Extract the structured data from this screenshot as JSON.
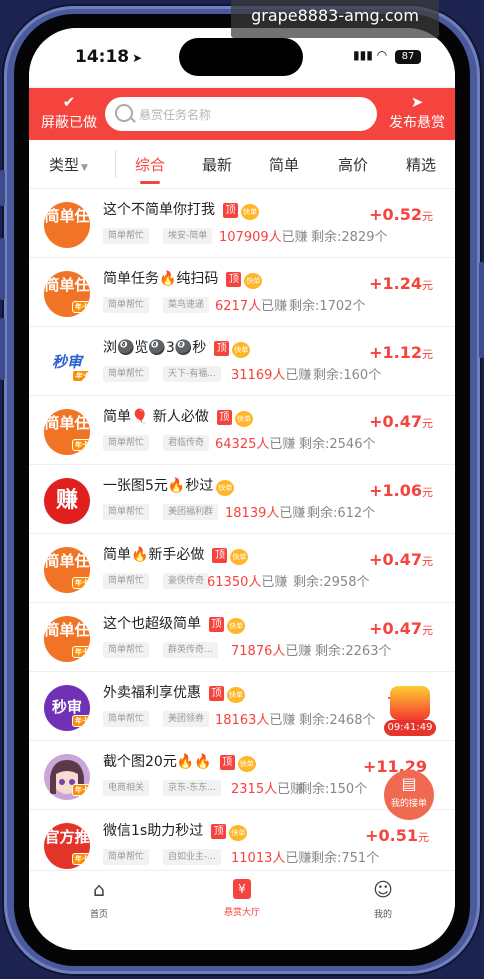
{
  "status_bar": {
    "time": "14:18",
    "battery": "87"
  },
  "watermark": "grape8883-amg.com",
  "header": {
    "left_label": "屏蔽已做",
    "search_placeholder": "悬赏任务名称",
    "right_label": "发布悬赏"
  },
  "tabs": {
    "filter_label": "类型",
    "items": [
      "综合",
      "最新",
      "简单",
      "高价",
      "精选"
    ],
    "active": "综合"
  },
  "tags": {
    "top": "顶",
    "fast": "快单",
    "card": "年卡"
  },
  "tasks": [
    {
      "avatar_text": "简单任",
      "title": "这个不简单你打我",
      "chip1": "简单帮忙",
      "chip2": "埃安-简单",
      "earned": "107909人",
      "earned_suffix": "已赚",
      "remaining": "剩余:2829个",
      "price": "+0.52",
      "unit": "元"
    },
    {
      "avatar_text": "简单任",
      "title": "简单任务🔥纯扫码",
      "chip1": "简单帮忙",
      "chip2": "菜鸟速递",
      "earned": "6217人",
      "earned_suffix": "已赚",
      "remaining": "剩余:1702个",
      "price": "+1.24",
      "unit": "元"
    },
    {
      "avatar_text": "秒审",
      "title": "浏🎱览🎱3🎱秒",
      "chip1": "简单帮忙",
      "chip2": "天下-有福...",
      "earned": "31169人",
      "earned_suffix": "已赚",
      "remaining": "剩余:160个",
      "price": "+1.12",
      "unit": "元"
    },
    {
      "avatar_text": "简单任",
      "title": "简单🎈 新人必做",
      "chip1": "简单帮忙",
      "chip2": "君临传奇",
      "earned": "64325人",
      "earned_suffix": "已赚",
      "remaining": "剩余:2546个",
      "price": "+0.47",
      "unit": "元"
    },
    {
      "avatar_text": "赚",
      "title": "一张图5元🔥秒过",
      "chip1": "简单帮忙",
      "chip2": "美团福利群",
      "earned": "18139人",
      "earned_suffix": "已赚",
      "remaining": "剩余:612个",
      "price": "+1.06",
      "unit": "元"
    },
    {
      "avatar_text": "简单任",
      "title": "简单🔥新手必做",
      "chip1": "简单帮忙",
      "chip2": "豪侠传奇",
      "earned": "61350人",
      "earned_suffix": "已赚",
      "remaining": "剩余:2958个",
      "price": "+0.47",
      "unit": "元"
    },
    {
      "avatar_text": "简单任",
      "title": "这个也超级简单",
      "chip1": "简单帮忙",
      "chip2": "群英传奇...",
      "earned": "71876人",
      "earned_suffix": "已赚",
      "remaining": "剩余:2263个",
      "price": "+0.47",
      "unit": "元"
    },
    {
      "avatar_text": "秒审",
      "title": "外卖福利享优惠",
      "chip1": "简单帮忙",
      "chip2": "美团领券",
      "earned": "18163人",
      "earned_suffix": "已赚",
      "remaining": "剩余:2468个",
      "price": "+1",
      "unit": ""
    },
    {
      "avatar_text": "",
      "title": "截个图20元🔥🔥",
      "chip1": "电商相关",
      "chip2": "京东-东东...",
      "earned": "2315人",
      "earned_suffix": "已赚",
      "remaining": "剩余:150个",
      "price": "+11.29",
      "unit": ""
    },
    {
      "avatar_text": "官方推",
      "title": "微信1s助力秒过",
      "chip1": "简单帮忙",
      "chip2": "自如业主-...",
      "earned": "11013人",
      "earned_suffix": "已赚",
      "remaining": "剩余:751个",
      "price": "+0.51",
      "unit": "元"
    }
  ],
  "floating": {
    "timer": "09:41:49",
    "my_orders": "我的接单"
  },
  "bottom_nav": {
    "home": "首页",
    "hall": "悬赏大厅",
    "mine": "我的"
  },
  "colors": {
    "accent": "#f5433e",
    "price": "#f5433e"
  }
}
